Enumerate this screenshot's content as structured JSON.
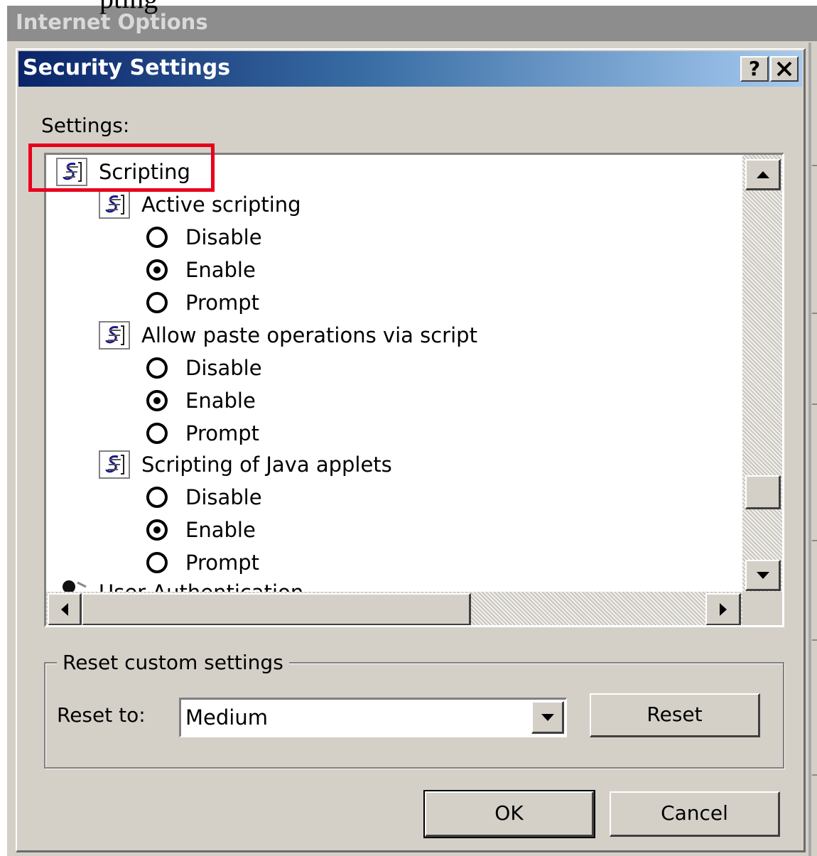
{
  "background": {
    "fragment_text": "pting",
    "window_title": "Internet Options"
  },
  "dialog": {
    "title": "Security Settings",
    "help_button": "?",
    "close_button": "✕",
    "settings_label": "Settings:"
  },
  "tree": {
    "root": {
      "label": "Scripting",
      "icon": "script-icon",
      "highlighted": true
    },
    "groups": [
      {
        "label": "Active scripting",
        "icon": "script-icon",
        "options": [
          {
            "label": "Disable",
            "selected": false
          },
          {
            "label": "Enable",
            "selected": true
          },
          {
            "label": "Prompt",
            "selected": false
          }
        ]
      },
      {
        "label": "Allow paste operations via script",
        "icon": "script-icon",
        "options": [
          {
            "label": "Disable",
            "selected": false
          },
          {
            "label": "Enable",
            "selected": true
          },
          {
            "label": "Prompt",
            "selected": false
          }
        ]
      },
      {
        "label": "Scripting of Java applets",
        "icon": "script-icon",
        "options": [
          {
            "label": "Disable",
            "selected": false
          },
          {
            "label": "Enable",
            "selected": true
          },
          {
            "label": "Prompt",
            "selected": false
          }
        ]
      }
    ],
    "partial_next": {
      "label": "User Authentication",
      "icon": "user-auth-icon"
    },
    "vertical_scroll_position": 0.85
  },
  "reset_group": {
    "legend": "Reset custom settings",
    "reset_to_label": "Reset to:",
    "selected_level": "Medium",
    "reset_button": "Reset"
  },
  "buttons": {
    "ok": "OK",
    "cancel": "Cancel"
  },
  "colors": {
    "title_bar_start": "#0a246a",
    "title_bar_end": "#a6caf0",
    "dialog_face": "#d4d0c8",
    "highlight_box": "#e8001c"
  }
}
